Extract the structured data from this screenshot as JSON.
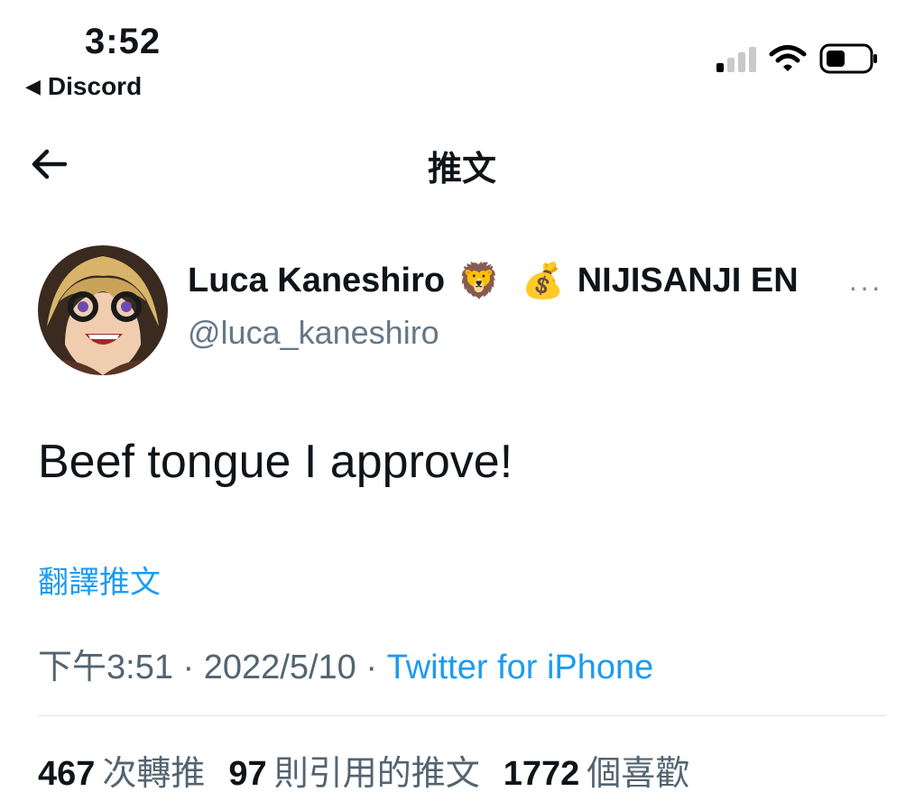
{
  "status_bar": {
    "time": "3:52",
    "back_app": "Discord",
    "back_icon": "triangle-left",
    "signal_icon": "cellular-signal",
    "wifi_icon": "wifi",
    "battery_icon": "battery"
  },
  "nav": {
    "back_icon": "arrow-left",
    "title": "推文"
  },
  "author": {
    "name": "Luca Kaneshiro",
    "emoji1": "🦁",
    "emoji2": "💰",
    "org": "NIJISANJI EN",
    "handle": "@luca_kaneshiro",
    "more_label": "···"
  },
  "tweet": {
    "text": "Beef tongue I approve!",
    "translate": "翻譯推文",
    "time": "下午3:51",
    "sep1": " · ",
    "date": "2022/5/10",
    "sep2": " · ",
    "source": "Twitter for iPhone"
  },
  "stats": {
    "retweets_count": "467",
    "retweets_label": "次轉推",
    "quotes_count": "97",
    "quotes_label": "則引用的推文",
    "likes_count": "1772",
    "likes_label": "個喜歡"
  },
  "colors": {
    "link": "#1d9bf0",
    "muted": "#536471",
    "text": "#0f1419"
  }
}
